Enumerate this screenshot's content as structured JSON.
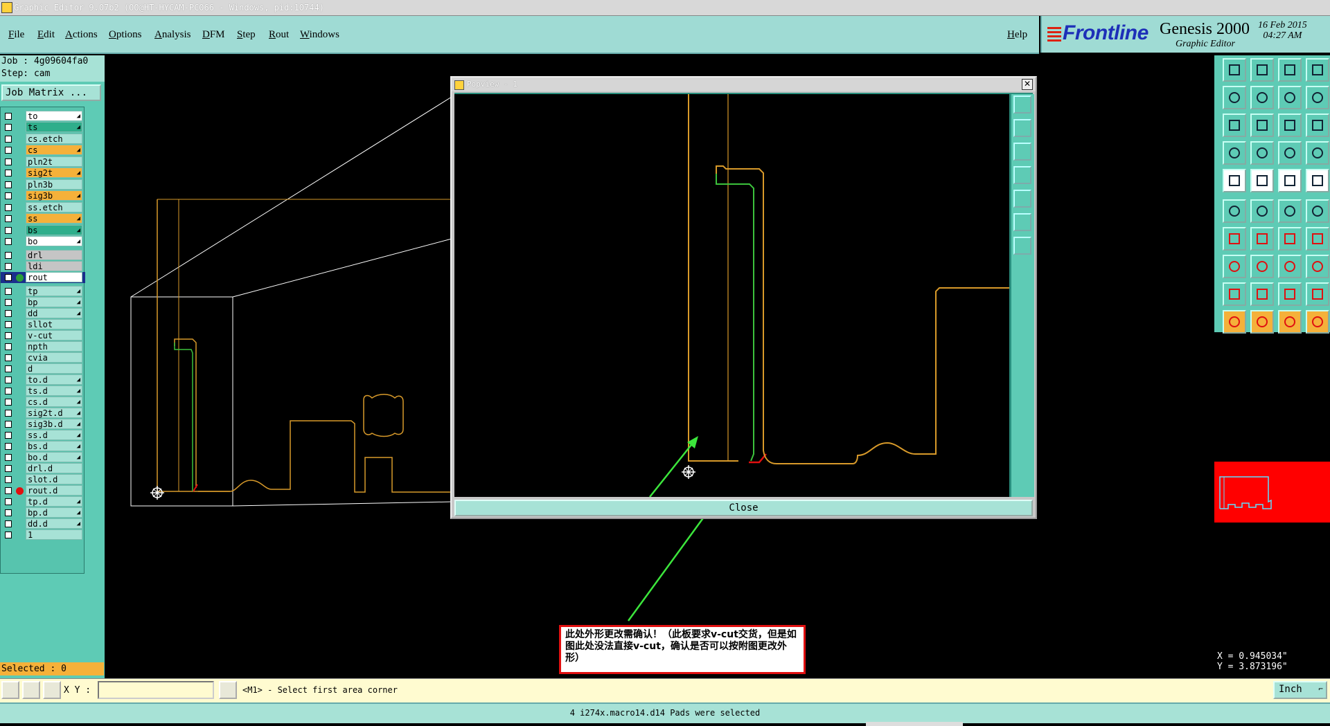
{
  "window": {
    "title": "Graphic Editor 9.07b2 (OO@HT-HYCAM-PC066 - Windows, pid:10744)"
  },
  "menu": [
    "File",
    "Edit",
    "Actions",
    "Options",
    "Analysis",
    "DFM",
    "Step",
    "Rout",
    "Windows"
  ],
  "help_label": "Help",
  "brand": {
    "logo": "Frontline",
    "app": "Genesis 2000",
    "sub": "Graphic Editor",
    "date": "16 Feb 2015",
    "time": "04:27 AM"
  },
  "job": {
    "job_line": "Job : 4g09604fa0",
    "step_line": "Step: cam",
    "matrix_label": "Job Matrix ..."
  },
  "layers": [
    {
      "name": "to",
      "style": "white",
      "icon": true
    },
    {
      "name": "ts",
      "style": "teal",
      "icon": true
    },
    {
      "name": "cs.etch",
      "style": "",
      "icon": false
    },
    {
      "name": "cs",
      "style": "orange",
      "icon": true
    },
    {
      "name": "pln2t",
      "style": "",
      "icon": false
    },
    {
      "name": "sig2t",
      "style": "orange",
      "icon": true
    },
    {
      "name": "pln3b",
      "style": "",
      "icon": false
    },
    {
      "name": "sig3b",
      "style": "orange",
      "icon": true
    },
    {
      "name": "ss.etch",
      "style": "",
      "icon": false
    },
    {
      "name": "ss",
      "style": "orange",
      "icon": true
    },
    {
      "name": "bs",
      "style": "teal",
      "icon": true
    },
    {
      "name": "bo",
      "style": "white",
      "icon": true
    },
    {
      "name": "drl",
      "style": "grey",
      "icon": false
    },
    {
      "name": "ldi",
      "style": "grey",
      "icon": false
    },
    {
      "name": "rout",
      "style": "white",
      "icon": false,
      "dot": "#2a9e38",
      "sel": true
    },
    {
      "name": "tp",
      "style": "",
      "icon": true
    },
    {
      "name": "bp",
      "style": "",
      "icon": true
    },
    {
      "name": "dd",
      "style": "",
      "icon": true
    },
    {
      "name": "sllot",
      "style": "",
      "icon": false
    },
    {
      "name": "v-cut",
      "style": "",
      "icon": false
    },
    {
      "name": "npth",
      "style": "",
      "icon": false
    },
    {
      "name": "cvia",
      "style": "",
      "icon": false
    },
    {
      "name": "d",
      "style": "",
      "icon": false
    },
    {
      "name": "to.d",
      "style": "",
      "icon": true
    },
    {
      "name": "ts.d",
      "style": "",
      "icon": true
    },
    {
      "name": "cs.d",
      "style": "",
      "icon": true
    },
    {
      "name": "sig2t.d",
      "style": "",
      "icon": true
    },
    {
      "name": "sig3b.d",
      "style": "",
      "icon": true
    },
    {
      "name": "ss.d",
      "style": "",
      "icon": true
    },
    {
      "name": "bs.d",
      "style": "",
      "icon": true
    },
    {
      "name": "bo.d",
      "style": "",
      "icon": true
    },
    {
      "name": "drl.d",
      "style": "",
      "icon": false
    },
    {
      "name": "slot.d",
      "style": "",
      "icon": false
    },
    {
      "name": "rout.d",
      "style": "",
      "icon": false,
      "dot": "#e01010"
    },
    {
      "name": "tp.d",
      "style": "",
      "icon": true
    },
    {
      "name": "bp.d",
      "style": "",
      "icon": true
    },
    {
      "name": "dd.d",
      "style": "",
      "icon": true
    },
    {
      "name": "1",
      "style": "",
      "icon": false
    }
  ],
  "selected_label": "Selected : 0",
  "popview": {
    "title": "Popview - 1",
    "close_label": "Close",
    "close_x": "✕"
  },
  "annotation": {
    "text": "此处外形更改需确认！（此板要求v-cut交货，但是如图此处没法直接v-cut，确认是否可以按附图更改外形）"
  },
  "coords": {
    "x": "X = 0.945034\"",
    "y": "Y = 3.873196\""
  },
  "cmd": {
    "xy_label": "X Y :",
    "prompt": "<M1> - Select first area corner",
    "unit": "Inch",
    "input_value": ""
  },
  "status": "4 i274x.macro14.d14 Pads were selected",
  "colors": {
    "outline": "#d89a2a",
    "green": "#3cc23c",
    "red": "#e01010",
    "panel": "#5ecbb5"
  }
}
